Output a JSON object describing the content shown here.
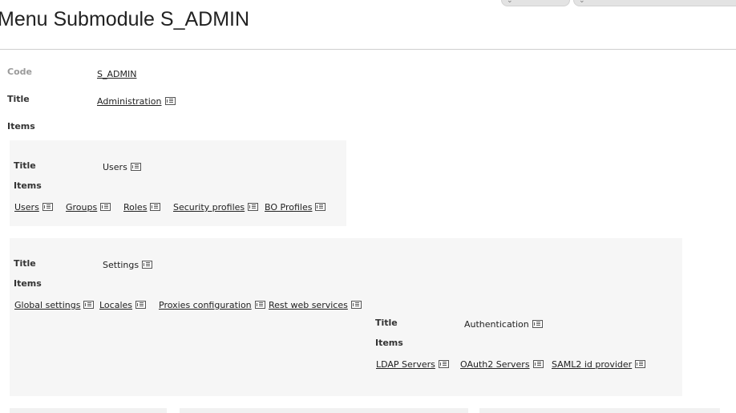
{
  "page": {
    "title": "Menu Submodule S_ADMIN"
  },
  "fields": {
    "code_label": "Code",
    "code_value": "S_ADMIN",
    "title_label": "Title",
    "title_value": "Administration",
    "items_label": "Items"
  },
  "groups": [
    {
      "title_label": "Title",
      "title_value": "Users",
      "items_label": "Items",
      "items": [
        "Users",
        "Groups",
        "Roles",
        "Security profiles",
        "BO Profiles"
      ]
    },
    {
      "title_label": "Title",
      "title_value": "Settings",
      "items_label": "Items",
      "items": [
        "Global settings",
        "Locales",
        "Proxies configuration",
        "Rest web services"
      ],
      "subgroup": {
        "title_label": "Title",
        "title_value": "Authentication",
        "items_label": "Items",
        "items": [
          "LDAP Servers",
          "OAuth2 Servers",
          "SAML2 id provider"
        ]
      }
    }
  ],
  "icons": {
    "edit": "edit-list-icon"
  }
}
